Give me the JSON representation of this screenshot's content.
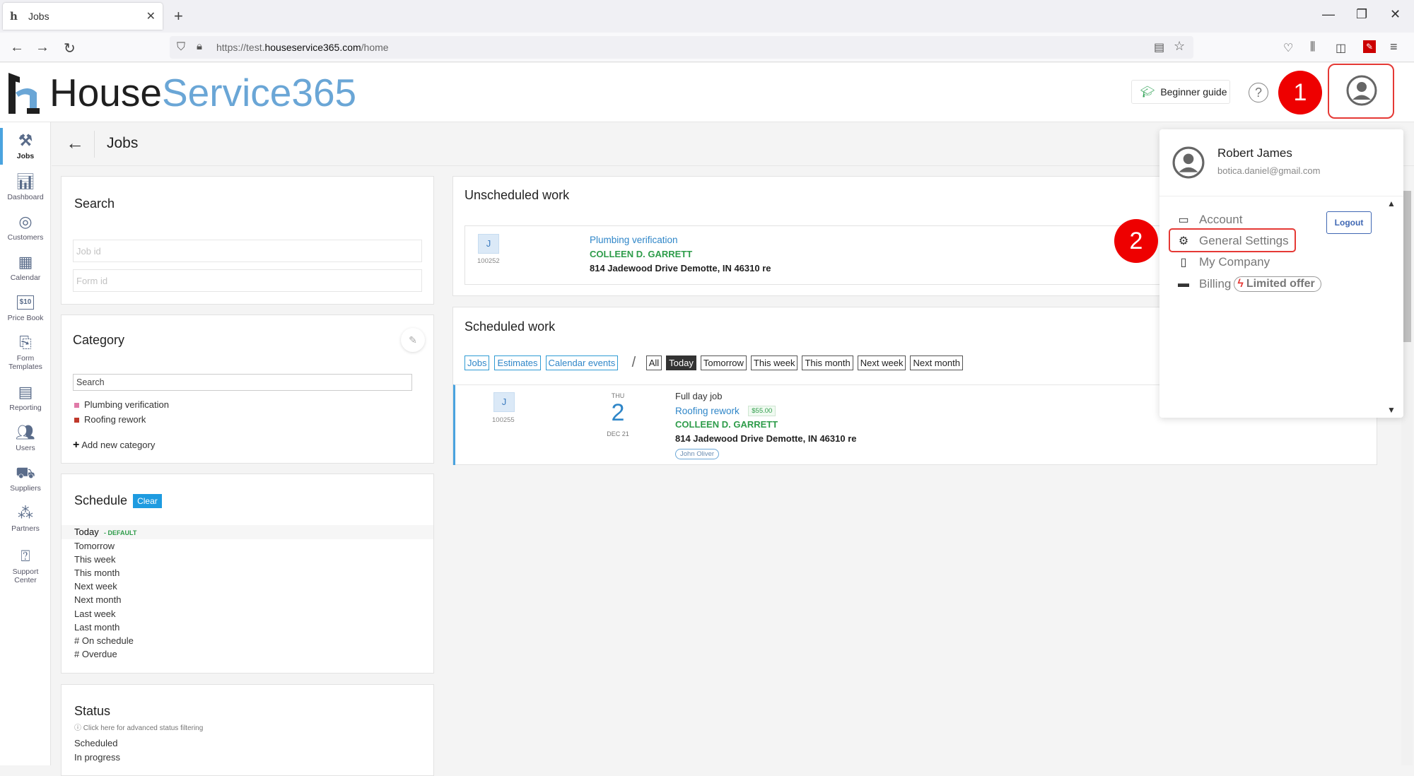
{
  "browser": {
    "tab_title": "Jobs",
    "url_prefix": "https://test.",
    "url_domain": "houseservice365.com",
    "url_path": "/home"
  },
  "header": {
    "logo_part1": "House",
    "logo_part2": "Service365",
    "beginner_guide": "Beginner guide",
    "help": "?",
    "step1": "1",
    "step2": "2"
  },
  "sidebar": {
    "items": [
      {
        "label": "Jobs",
        "icon": "tools-icon"
      },
      {
        "label": "Dashboard",
        "icon": "bar-chart-icon"
      },
      {
        "label": "Customers",
        "icon": "target-icon"
      },
      {
        "label": "Calendar",
        "icon": "calendar-icon"
      },
      {
        "label": "Price Book",
        "icon": "price-tag-icon",
        "icon_text": "$10"
      },
      {
        "label": "Form",
        "label2": "Templates",
        "icon": "form-icon"
      },
      {
        "label": "Reporting",
        "icon": "report-icon"
      },
      {
        "label": "Users",
        "icon": "users-icon"
      },
      {
        "label": "Suppliers",
        "icon": "truck-icon"
      },
      {
        "label": "Partners",
        "icon": "partners-icon"
      },
      {
        "label": "Support",
        "label2": "Center",
        "icon": "support-icon"
      }
    ]
  },
  "page": {
    "title": "Jobs"
  },
  "search": {
    "title": "Search",
    "job_id_placeholder": "Job id",
    "form_id_placeholder": "Form id"
  },
  "category": {
    "title": "Category",
    "search_value": "Search",
    "items": [
      {
        "label": "Plumbing verification",
        "color": "#e07aa8"
      },
      {
        "label": "Roofing rework",
        "color": "#c0392b"
      }
    ],
    "add_new": "Add new category"
  },
  "schedule": {
    "title": "Schedule",
    "clear": "Clear",
    "today": "Today",
    "default_tag": "- DEFAULT",
    "items": [
      "Tomorrow",
      "This week",
      "This month",
      "Next week",
      "Next month",
      "Last week",
      "Last month",
      "# On schedule",
      "# Overdue"
    ]
  },
  "status": {
    "title": "Status",
    "hint": "Click here for advanced status filtering",
    "items": [
      "Scheduled",
      "In progress"
    ]
  },
  "unscheduled": {
    "title": "Unscheduled work",
    "job": {
      "badge": "J",
      "number": "100252",
      "category": "Plumbing verification",
      "customer": "COLLEEN D. GARRETT",
      "address": "814 Jadewood Drive Demotte, IN 46310 re"
    }
  },
  "scheduled": {
    "title": "Scheduled work",
    "type_filters": [
      "Jobs",
      "Estimates",
      "Calendar events"
    ],
    "separator": "/",
    "time_filters": [
      "All",
      "Today",
      "Tomorrow",
      "This week",
      "This month",
      "Next week",
      "Next month"
    ],
    "selected_time_filter": "Today",
    "job": {
      "badge": "J",
      "number": "100255",
      "weekday": "THU",
      "day": "2",
      "month": "DEC 21",
      "type": "Full day job",
      "category": "Roofing rework",
      "price": "$55.00",
      "customer": "COLLEEN D. GARRETT",
      "address": "814 Jadewood Drive Demotte, IN 46310 re",
      "assignee": "John Oliver"
    }
  },
  "user_menu": {
    "name": "Robert James",
    "email": "botica.daniel@gmail.com",
    "logout": "Logout",
    "items": [
      {
        "label": "Account",
        "icon": "id-card-icon"
      },
      {
        "label": "General Settings",
        "icon": "gear-icon"
      },
      {
        "label": "My Company",
        "icon": "building-icon"
      },
      {
        "label": "Billing",
        "icon": "credit-card-icon"
      }
    ],
    "limited_offer": "Limited offer"
  },
  "colors": {
    "accent_blue": "#2f86c8",
    "logo_blue": "#6aa6d6",
    "annotation_red": "#ee0000",
    "customer_green": "#2e9c4a"
  }
}
